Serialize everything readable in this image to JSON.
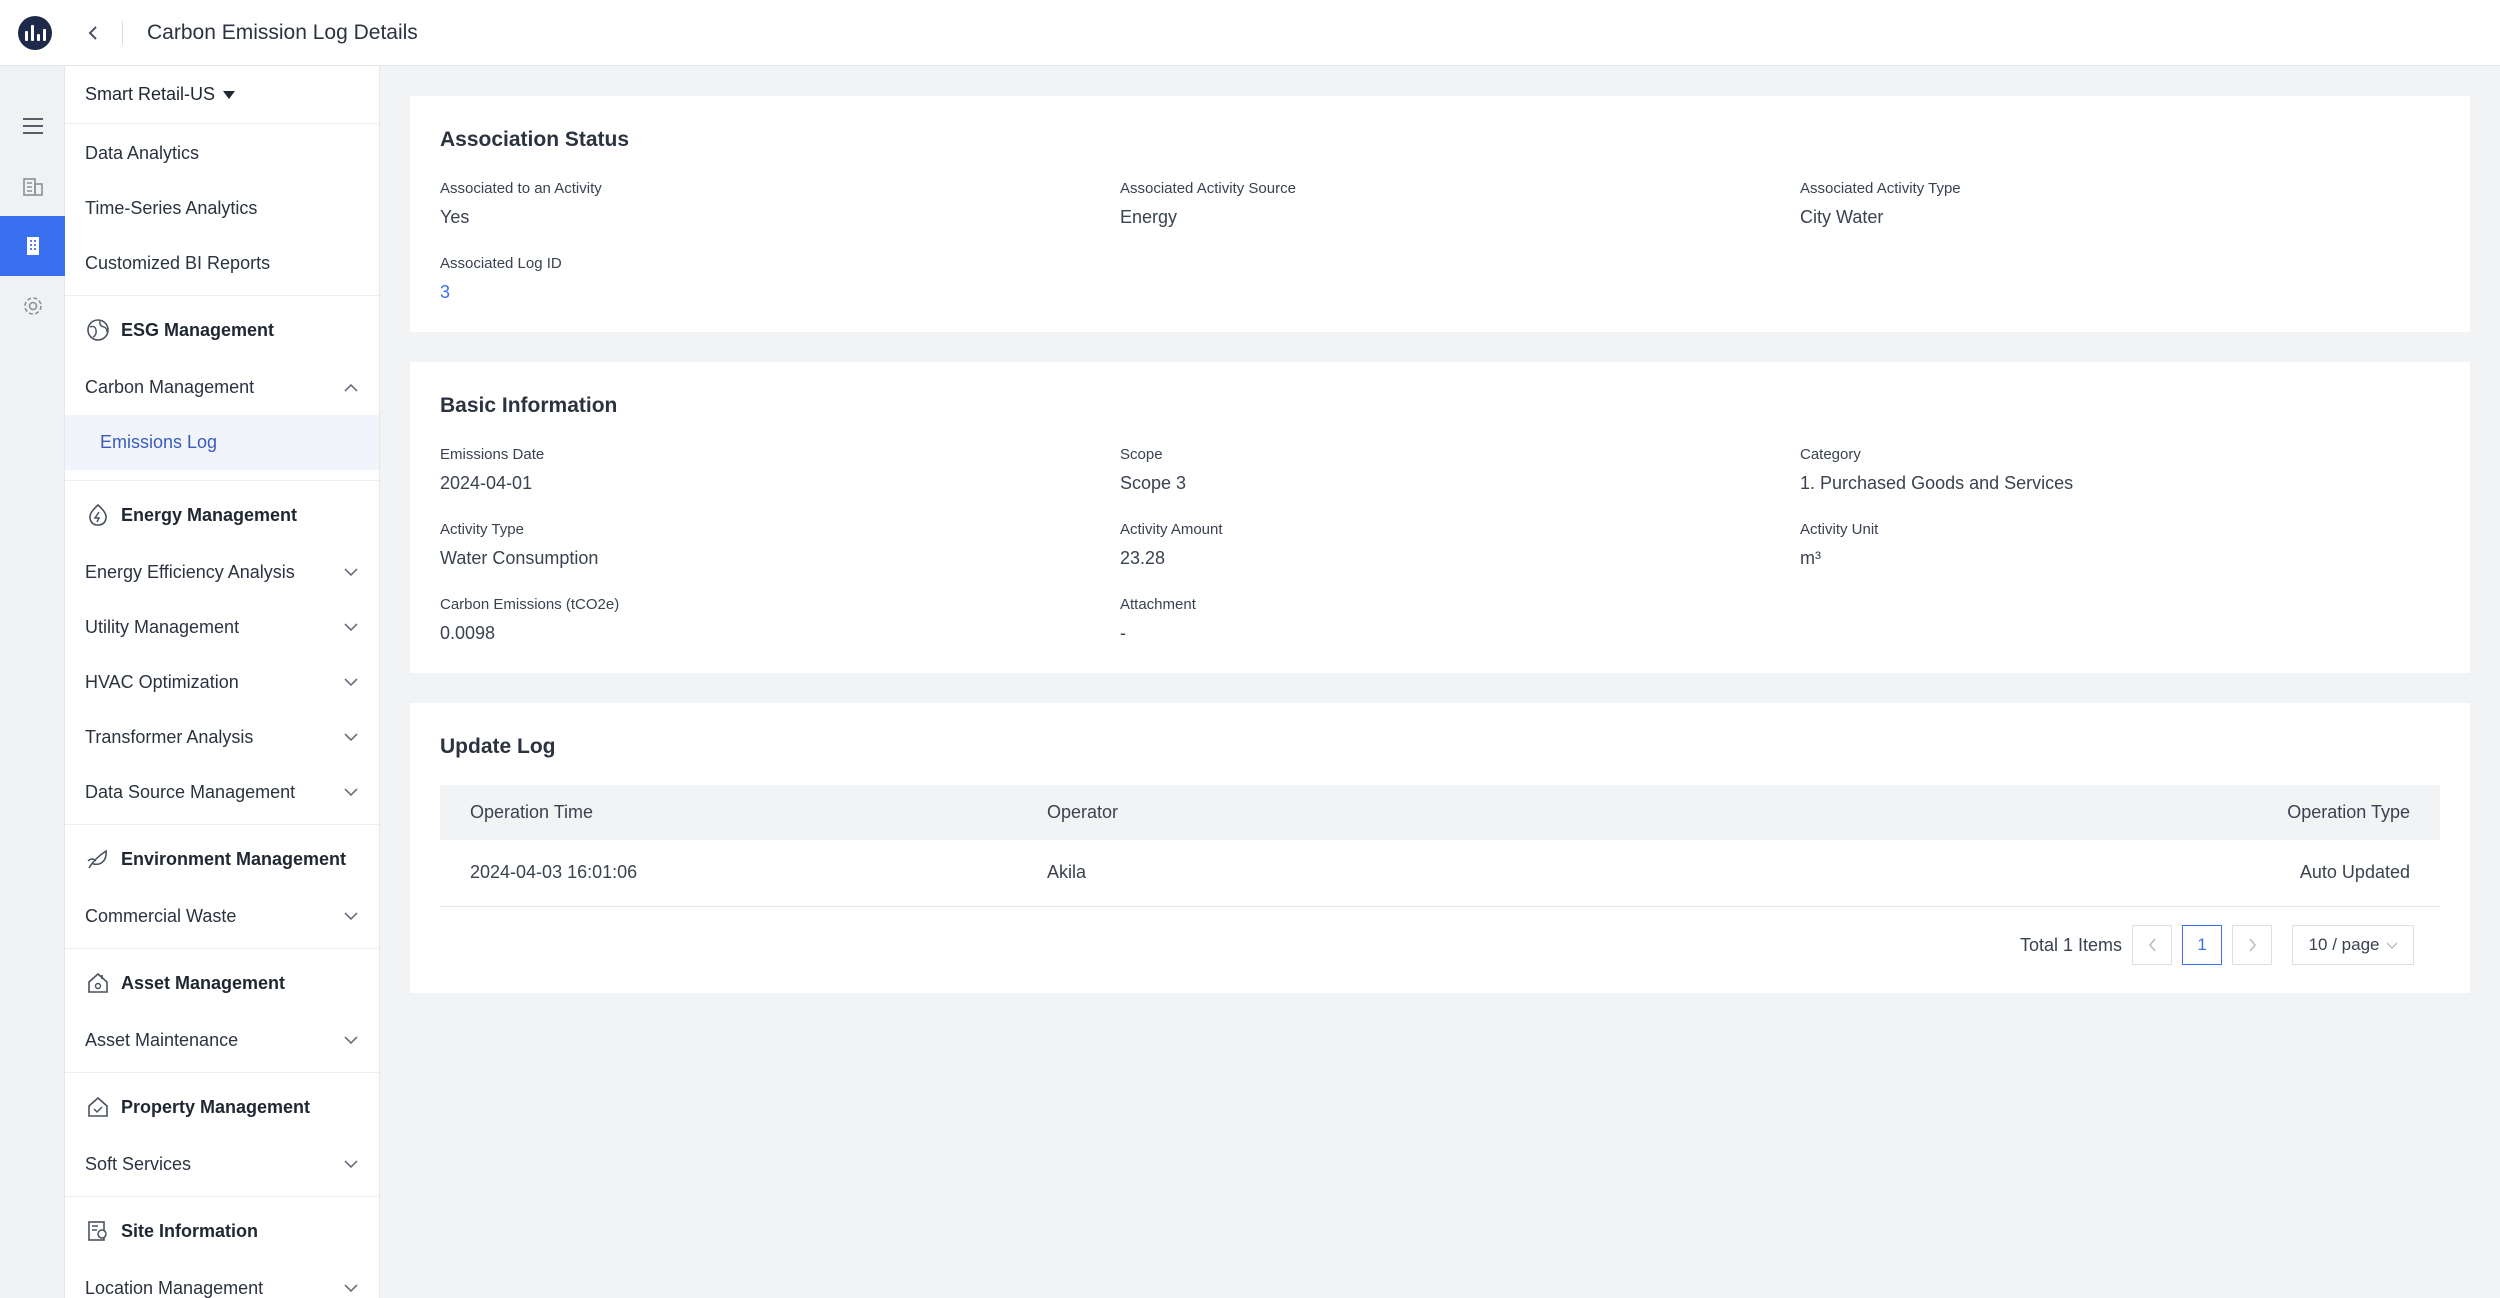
{
  "header": {
    "title": "Carbon Emission Log Details"
  },
  "rail": {
    "items": [
      "menu-icon",
      "building-icon",
      "office-icon",
      "gear-icon"
    ],
    "active_index": 2
  },
  "sidebar": {
    "org": "Smart Retail-US",
    "top_items": [
      "Data Analytics",
      "Time-Series Analytics",
      "Customized BI Reports"
    ],
    "groups": [
      {
        "title": "ESG Management",
        "icon": "globe-icon",
        "items": [
          {
            "label": "Carbon Management",
            "expanded": true,
            "children": [
              "Emissions Log"
            ]
          }
        ]
      },
      {
        "title": "Energy Management",
        "icon": "energy-icon",
        "items": [
          {
            "label": "Energy Efficiency Analysis"
          },
          {
            "label": "Utility Management"
          },
          {
            "label": "HVAC Optimization"
          },
          {
            "label": "Transformer Analysis"
          },
          {
            "label": "Data Source Management"
          }
        ]
      },
      {
        "title": "Environment Management",
        "icon": "leaf-icon",
        "items": [
          {
            "label": "Commercial Waste"
          }
        ]
      },
      {
        "title": "Asset Management",
        "icon": "asset-icon",
        "items": [
          {
            "label": "Asset Maintenance"
          }
        ]
      },
      {
        "title": "Property Management",
        "icon": "property-icon",
        "items": [
          {
            "label": "Soft Services"
          }
        ]
      },
      {
        "title": "Site Information",
        "icon": "site-icon",
        "items": [
          {
            "label": "Location Management"
          }
        ]
      }
    ]
  },
  "association": {
    "title": "Association Status",
    "associated_label": "Associated to an Activity",
    "associated_value": "Yes",
    "source_label": "Associated Activity Source",
    "source_value": "Energy",
    "type_label": "Associated Activity Type",
    "type_value": "City Water",
    "log_id_label": "Associated Log ID",
    "log_id_value": "3"
  },
  "basic": {
    "title": "Basic Information",
    "emissions_date_label": "Emissions Date",
    "emissions_date_value": "2024-04-01",
    "scope_label": "Scope",
    "scope_value": "Scope 3",
    "category_label": "Category",
    "category_value": "1. Purchased Goods and Services",
    "activity_type_label": "Activity Type",
    "activity_type_value": "Water Consumption",
    "activity_amount_label": "Activity Amount",
    "activity_amount_value": "23.28",
    "activity_unit_label": "Activity Unit",
    "activity_unit_value": "m³",
    "carbon_label": "Carbon Emissions (tCO2e)",
    "carbon_value": "0.0098",
    "attachment_label": "Attachment",
    "attachment_value": "-"
  },
  "update_log": {
    "title": "Update Log",
    "columns": [
      "Operation Time",
      "Operator",
      "Operation Type"
    ],
    "rows": [
      [
        "2024-04-03 16:01:06",
        "Akila",
        "Auto Updated"
      ]
    ],
    "total_text": "Total 1 Items",
    "current_page": "1",
    "page_size": "10 / page"
  }
}
